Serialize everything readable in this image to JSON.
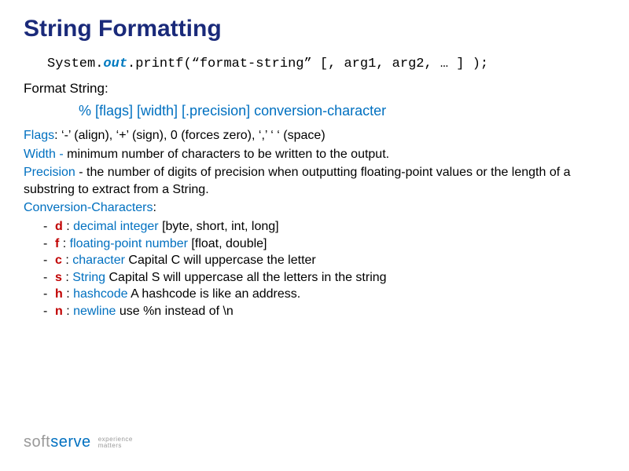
{
  "title": "String Formatting",
  "syntax": {
    "pre": "System.",
    "out": "out",
    "post": ".printf(“format-string” [, arg1, arg2, … ] );"
  },
  "format_label": "Format String:",
  "format_spec": "% [flags] [width] [.precision] conversion-character",
  "flags": {
    "label": "Flags",
    "text": ": ‘-’ (align), ‘+’ (sign), 0 (forces zero), ‘,’ ‘  ‘ (space)"
  },
  "width": {
    "label": "Width",
    "dash": " - ",
    "text": "minimum number of characters to be written to the output."
  },
  "precision": {
    "label": "Precision",
    "text": " - the number of digits of precision when outputting floating-point values or the length of a substring to extract from a String."
  },
  "conv_label": "Conversion-Characters",
  "conv_colon": ":",
  "conversions": [
    {
      "c": "d",
      "desc": "decimal integer",
      "tail": " [byte, short, int, long]"
    },
    {
      "c": "f",
      "desc": "floating-point number",
      "tail": " [float, double]"
    },
    {
      "c": "c",
      "desc": "character",
      "tail": " Capital C will uppercase the letter"
    },
    {
      "c": "s",
      "desc": "String",
      "tail": " Capital S will uppercase all the letters in the string"
    },
    {
      "c": "h",
      "desc": "hashcode",
      "tail": " A hashcode is like an address."
    },
    {
      "c": "n",
      "desc": "newline",
      "tail": " use %n instead of \\n"
    }
  ],
  "logo": {
    "soft": "soft",
    "serve": "serve",
    "tag1": "experience",
    "tag2": "matters"
  }
}
